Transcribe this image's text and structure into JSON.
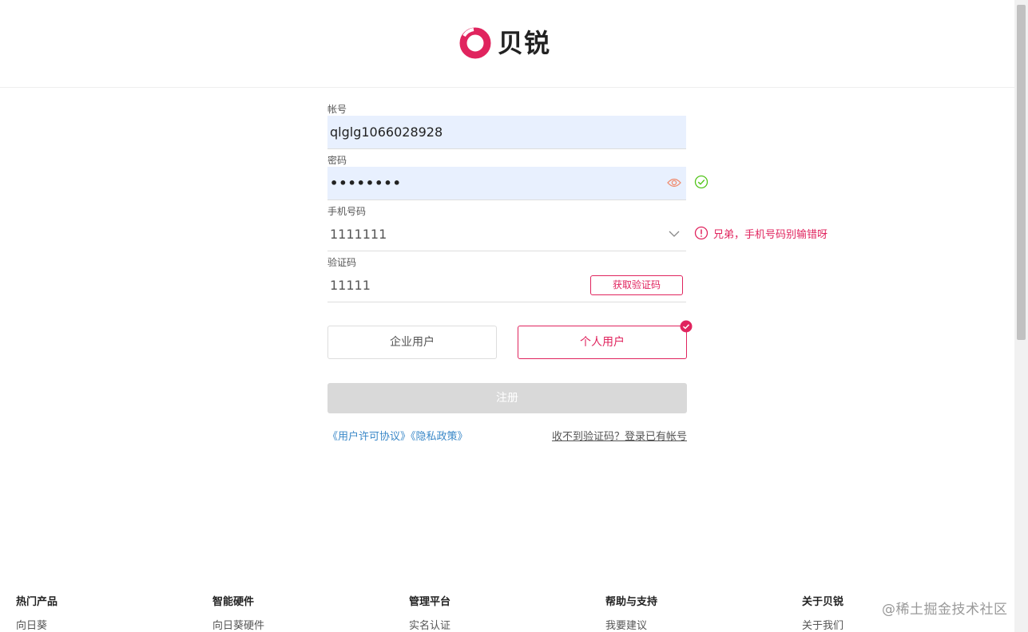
{
  "brand": {
    "name": "贝锐"
  },
  "form": {
    "account": {
      "label": "帐号",
      "value": "qlglg1066028928"
    },
    "password": {
      "label": "密码",
      "value": "••••••••"
    },
    "phone": {
      "label": "手机号码",
      "value": "1111111",
      "error": "兄弟，手机号码别输错呀"
    },
    "code": {
      "label": "验证码",
      "value": "11111",
      "button": "获取验证码"
    },
    "user_types": {
      "enterprise": "企业用户",
      "personal": "个人用户"
    },
    "submit": "注册",
    "agreements": "《用户许可协议》《隐私政策》",
    "login_link": "收不到验证码？登录已有帐号"
  },
  "footer": {
    "cols": [
      {
        "title": "热门产品",
        "item": "向日葵"
      },
      {
        "title": "智能硬件",
        "item": "向日葵硬件"
      },
      {
        "title": "管理平台",
        "item": "实名认证"
      },
      {
        "title": "帮助与支持",
        "item": "我要建议"
      },
      {
        "title": "关于贝锐",
        "item": "关于我们"
      }
    ]
  },
  "watermark": "@稀土掘金技术社区",
  "colors": {
    "accent": "#e0245e",
    "link": "#3a88c8",
    "success": "#52c41a",
    "autofill": "#e8f0fe"
  }
}
